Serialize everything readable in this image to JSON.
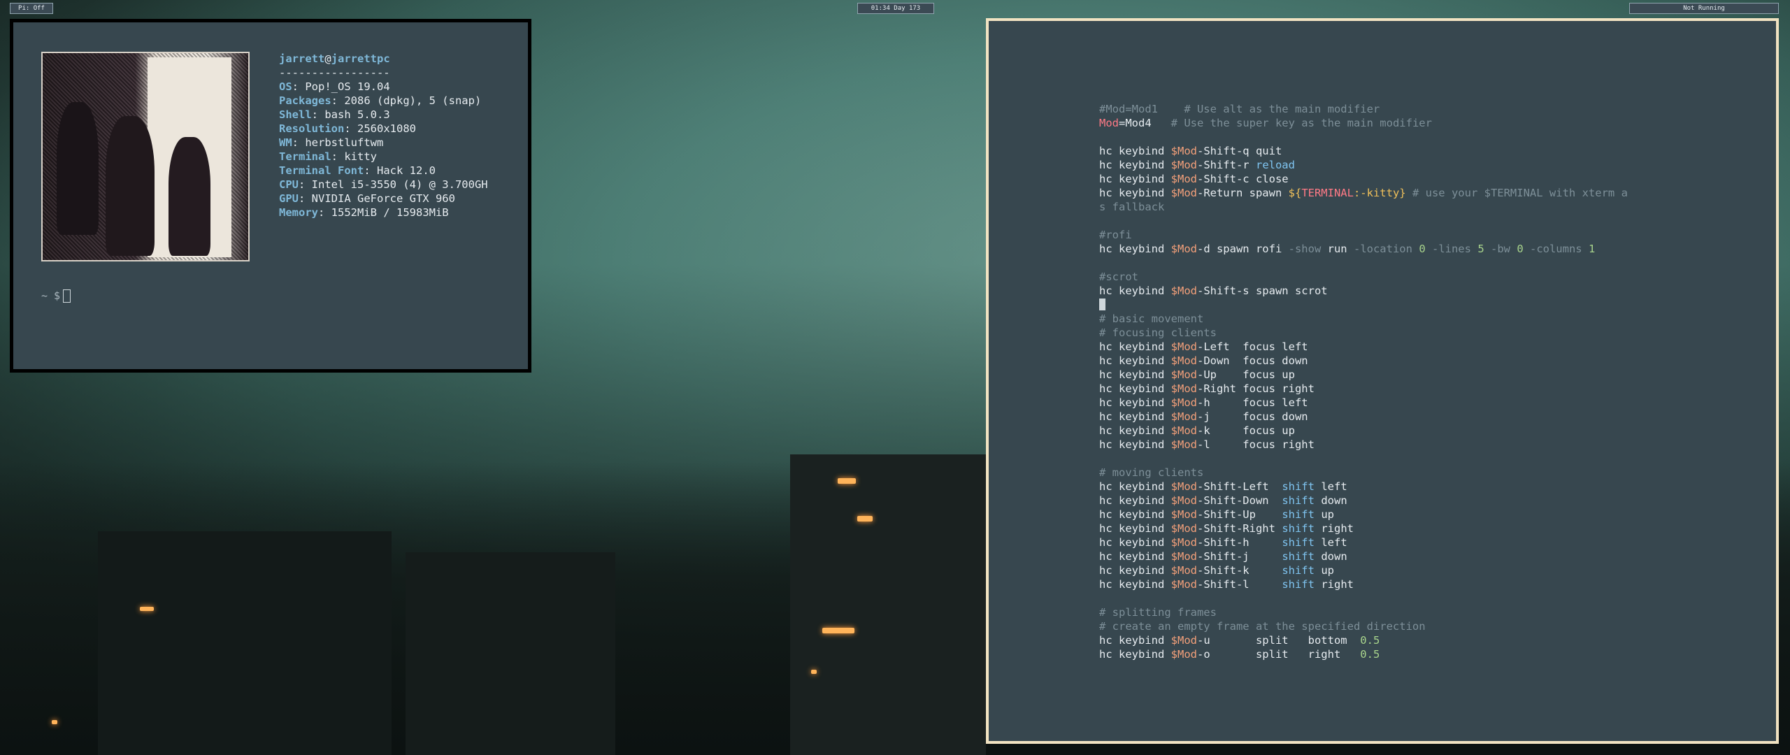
{
  "bar": {
    "left": "Pi: Off",
    "center": "01:34 Day 173",
    "right": "Not Running"
  },
  "neofetch": {
    "user": "jarrett",
    "at": "@",
    "host": "jarrettpc",
    "sep": "-----------------",
    "rows": [
      {
        "k": "OS",
        "v": "Pop!_OS 19.04"
      },
      {
        "k": "Packages",
        "v": "2086 (dpkg), 5 (snap)"
      },
      {
        "k": "Shell",
        "v": "bash 5.0.3"
      },
      {
        "k": "Resolution",
        "v": "2560x1080"
      },
      {
        "k": "WM",
        "v": "herbstluftwm"
      },
      {
        "k": "Terminal",
        "v": "kitty"
      },
      {
        "k": "Terminal Font",
        "v": "Hack 12.0"
      },
      {
        "k": "CPU",
        "v": "Intel i5-3550 (4) @ 3.700GH"
      },
      {
        "k": "GPU",
        "v": "NVIDIA GeForce GTX 960"
      },
      {
        "k": "Memory",
        "v": "1552MiB / 15983MiB"
      }
    ],
    "prompt": "~ $"
  },
  "config": {
    "mod1": "#Mod=Mod1    # Use alt as the main modifier",
    "mod4_var": "Mod",
    "mod4_rest": "=Mod4",
    "mod4_comment": "   # Use the super key as the main modifier",
    "hc": "hc keybind ",
    "modvar": "$Mod",
    "quit_key": "-Shift-q quit",
    "reload_key": "-Shift-r ",
    "reload": "reload",
    "close_key": "-Shift-c close",
    "return_key": "-Return spawn ",
    "terminal_a": "${",
    "terminal_b": "TERMINAL",
    "terminal_c": ":-kitty}",
    "terminal_comment": " # use your $TERMINAL with xterm a",
    "terminal_comment2": "s fallback",
    "rofi_comment": "#rofi",
    "rofi_key": "-d spawn rofi ",
    "rofi_show": "-show",
    "rofi_run": " run ",
    "rofi_loc": "-location",
    "rofi_0a": " 0 ",
    "rofi_lines": "-lines",
    "rofi_5": " 5 ",
    "rofi_bw": "-bw",
    "rofi_0b": " 0 ",
    "rofi_cols": "-columns",
    "rofi_1": " 1",
    "scrot_comment": "#scrot",
    "scrot_key": "-Shift-s spawn scrot",
    "basic_comment": "# basic movement",
    "focus_comment": "# focusing clients",
    "focus": [
      "-Left  focus left",
      "-Down  focus down",
      "-Up    focus up",
      "-Right focus right",
      "-h     focus left",
      "-j     focus down",
      "-k     focus up",
      "-l     focus right"
    ],
    "moving_comment": "# moving clients",
    "shift": [
      {
        "k": "-Shift-Left  ",
        "d": "left"
      },
      {
        "k": "-Shift-Down  ",
        "d": "down"
      },
      {
        "k": "-Shift-Up    ",
        "d": "up"
      },
      {
        "k": "-Shift-Right ",
        "d": "right"
      },
      {
        "k": "-Shift-h     ",
        "d": "left"
      },
      {
        "k": "-Shift-j     ",
        "d": "down"
      },
      {
        "k": "-Shift-k     ",
        "d": "up"
      },
      {
        "k": "-Shift-l     ",
        "d": "right"
      }
    ],
    "shift_word": "shift",
    "split_comment": "# splitting frames",
    "split_comment2": "# create an empty frame at the specified direction",
    "split_u": "-u       split   bottom  ",
    "split_o": "-o       split   right   ",
    "split_val": "0.5"
  }
}
